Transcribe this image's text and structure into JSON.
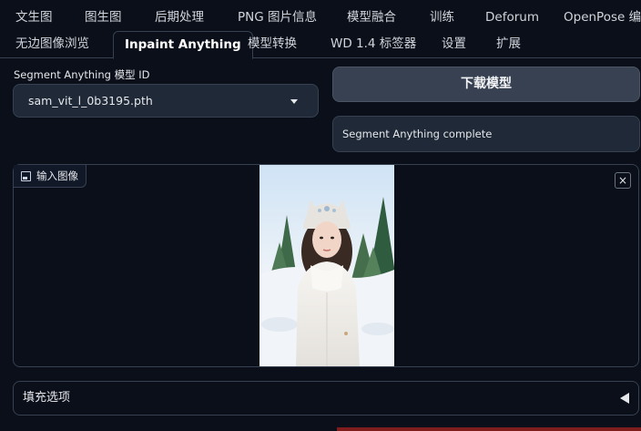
{
  "tabs_row1": [
    "文生图",
    "图生图",
    "后期处理",
    "PNG 图片信息",
    "模型融合",
    "训练",
    "Deforum",
    "OpenPose 编辑"
  ],
  "tabs_row2": [
    "无边图像浏览",
    "Inpaint Anything",
    "模型转换",
    "WD 1.4 标签器",
    "设置",
    "扩展"
  ],
  "active_tab": "Inpaint Anything",
  "model": {
    "label": "Segment Anything 模型 ID",
    "selected": "sam_vit_l_0b3195.pth"
  },
  "download_button": "下载模型",
  "status_text": "Segment Anything complete",
  "image_input": {
    "label": "输入图像",
    "close": "×"
  },
  "accordion": {
    "label": "填充选项"
  }
}
